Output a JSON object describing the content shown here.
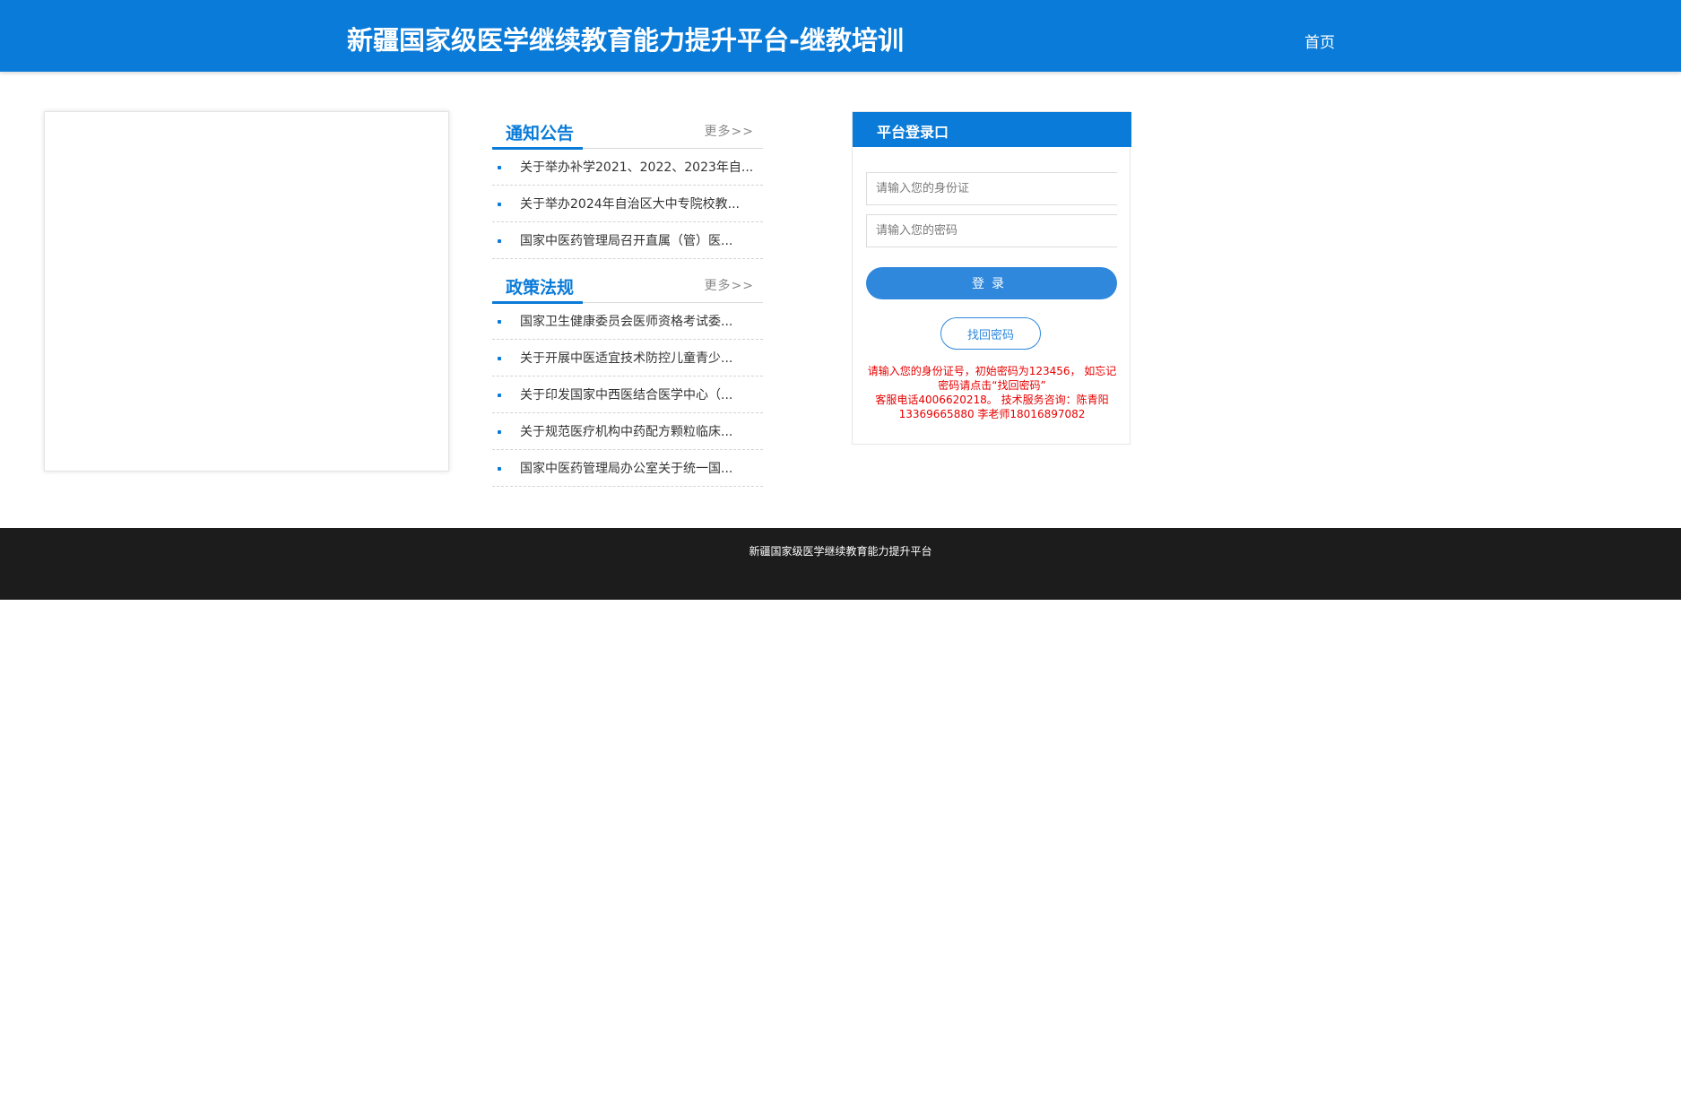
{
  "header": {
    "title": "新疆国家级医学继续教育能力提升平台-继教培训",
    "nav_home": "首页",
    "brand_color": "#0a7bd8"
  },
  "notices": {
    "title": "通知公告",
    "more": "更多>>",
    "items": [
      "关于举办补学2021、2022、2023年自...",
      "关于举办2024年自治区大中专院校教...",
      "国家中医药管理局召开直属（管）医..."
    ]
  },
  "policies": {
    "title": "政策法规",
    "more": "更多>>",
    "items": [
      "国家卫生健康委员会医师资格考试委...",
      "关于开展中医适宜技术防控儿童青少...",
      "关于印发国家中西医结合医学中心（...",
      "关于规范医疗机构中药配方颗粒临床...",
      "国家中医药管理局办公室关于统一国..."
    ]
  },
  "login": {
    "title": "平台登录口",
    "id_placeholder": "请输入您的身份证",
    "password_placeholder": "请输入您的密码",
    "login_button": "登录",
    "forgot_button": "找回密码",
    "note_line1": "请输入您的身份证号，初始密码为123456， 如忘记密码请点击“找回密码”",
    "note_line2": "客服电话4006620218。 技术服务咨询：陈青阳 13369665880 李老师18016897082"
  },
  "footer": {
    "text": "新疆国家级医学继续教育能力提升平台"
  }
}
